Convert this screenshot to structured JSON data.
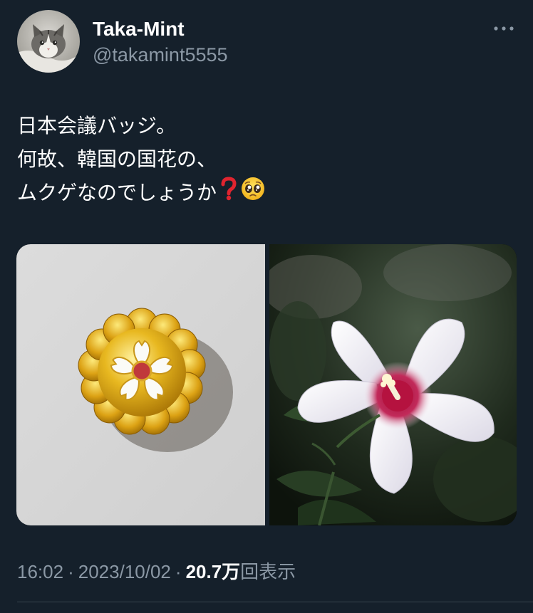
{
  "author": {
    "display_name": "Taka-Mint",
    "handle": "@takamint5555"
  },
  "more_menu": {
    "icon": "more-horizontal-icon"
  },
  "tweet": {
    "lines": [
      "日本会議バッジ。",
      "何故、韓国の国花の、",
      "ムクゲなのでしょうか"
    ],
    "emojis": [
      "red-question-mark-icon",
      "pleading-face-icon"
    ]
  },
  "media": {
    "photos": [
      {
        "subject": "gold-chrysanthemum-badge-with-sakura"
      },
      {
        "subject": "white-rose-of-sharon-flower"
      }
    ]
  },
  "meta": {
    "time": "16:02",
    "date": "2023/10/02",
    "separator": "·",
    "views_count": "20.7万",
    "views_label": "回表示"
  },
  "colors": {
    "background": "#15202b",
    "text_primary": "#ffffff",
    "text_secondary": "#8b98a5",
    "divider": "#38444d",
    "question_mark": "#e0242f"
  }
}
